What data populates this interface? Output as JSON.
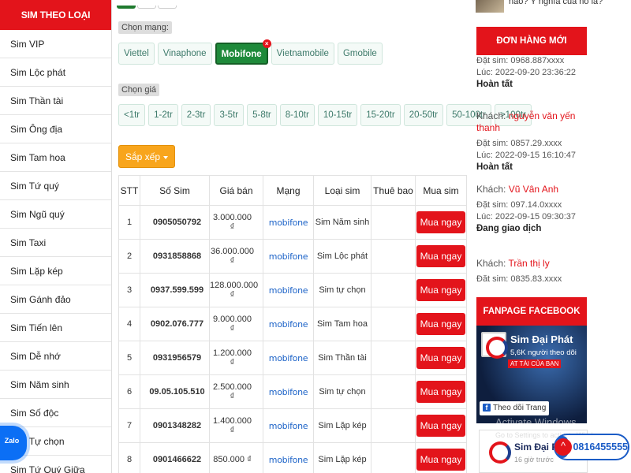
{
  "sidebar": {
    "title": "SIM THEO LOẠI",
    "items": [
      "Sim VIP",
      "Sim Lộc phát",
      "Sim Thần tài",
      "Sim Ông địa",
      "Sim Tam hoa",
      "Sim Tứ quý",
      "Sim Ngũ quý",
      "Sim Taxi",
      "Sim Lặp kép",
      "Sim Gánh đảo",
      "Sim Tiến lên",
      "Sim Dễ nhớ",
      "Sim Năm sinh",
      "Sim Số độc",
      "Sim Tự chọn",
      "Sim Tứ Quý Giữa"
    ]
  },
  "filters": {
    "network_label": "Chọn mạng:",
    "networks": [
      {
        "label": "Viettel",
        "active": false
      },
      {
        "label": "Vinaphone",
        "active": false
      },
      {
        "label": "Mobifone",
        "active": true
      },
      {
        "label": "Vietnamobile",
        "active": false
      },
      {
        "label": "Gmobile",
        "active": false
      }
    ],
    "price_label": "Chọn giá",
    "prices": [
      "<1tr",
      "1-2tr",
      "2-3tr",
      "3-5tr",
      "5-8tr",
      "8-10tr",
      "10-15tr",
      "15-20tr",
      "20-50tr",
      "50-100tr",
      ">100tr"
    ],
    "sort_label": "Sắp xếp"
  },
  "table": {
    "headers": [
      "STT",
      "Số Sim",
      "Giá bán",
      "Mạng",
      "Loại sim",
      "Thuê bao",
      "Mua sim"
    ],
    "network_logo": "mobifone",
    "buy_label": "Mua ngay",
    "rows": [
      {
        "stt": "1",
        "number": "0905050792",
        "price": "3.000.000 ₫",
        "type": "Sim Năm sinh"
      },
      {
        "stt": "2",
        "number": "0931858868",
        "price": "36.000.000 ₫",
        "type": "Sim Lộc phát"
      },
      {
        "stt": "3",
        "number": "0937.599.599",
        "price": "128.000.000 ₫",
        "type": "Sim tự chọn"
      },
      {
        "stt": "4",
        "number": "0902.076.777",
        "price": "9.000.000 ₫",
        "type": "Sim Tam hoa"
      },
      {
        "stt": "5",
        "number": "0931956579",
        "price": "1.200.000 ₫",
        "type": "Sim Thần tài"
      },
      {
        "stt": "6",
        "number": "09.05.105.510",
        "price": "2.500.000 ₫",
        "type": "Sim tự chọn"
      },
      {
        "stt": "7",
        "number": "0901348282",
        "price": "1.400.000 ₫",
        "type": "Sim Lặp kép"
      },
      {
        "stt": "8",
        "number": "0901466622",
        "price": "850.000 ₫",
        "type": "Sim Lặp kép"
      }
    ]
  },
  "right": {
    "snippet_text": "nào? Ý nghĩa của nó là?",
    "orders_title": "ĐƠN HÀNG MỚI",
    "orders": [
      {
        "customer": "",
        "sim": "Đặt sim: 0968.887xxxx",
        "time": "Lúc: 2022-09-20 23:36:22",
        "status": "Hoàn tất"
      },
      {
        "customer": "nguyễn văn yến thanh",
        "sim": "Đặt sim: 0857.29.xxxx",
        "time": "Lúc: 2022-09-15 16:10:47",
        "status": "Hoàn tất"
      },
      {
        "customer": "Vũ Vân Anh",
        "sim": "Đặt sim: 097.14.0xxxx",
        "time": "Lúc: 2022-09-15 09:30:37",
        "status": "Đang giao dịch"
      },
      {
        "customer": "Trần thị ly",
        "sim": "Đặt sim: 0835.83.xxxx",
        "time": "",
        "status": ""
      }
    ],
    "customer_prefix": "Khách: ",
    "fanpage_title": "FANPAGE FACEBOOK",
    "fb_name": "Sim Đại Phát",
    "fb_followers": "5,6K người theo dõi",
    "fb_tagline": "AT TÀI CỦA BẠN",
    "fb_follow_btn": "Theo dõi Trang",
    "fb_post_name": "Sim Đại Phát",
    "fb_post_time": "16 giờ trước"
  },
  "overlay": {
    "watermark": "Activate Windows",
    "watermark_sub": "Go to Settings to activate Windows.",
    "zalo": "Zalo",
    "phone": "0816455555"
  }
}
